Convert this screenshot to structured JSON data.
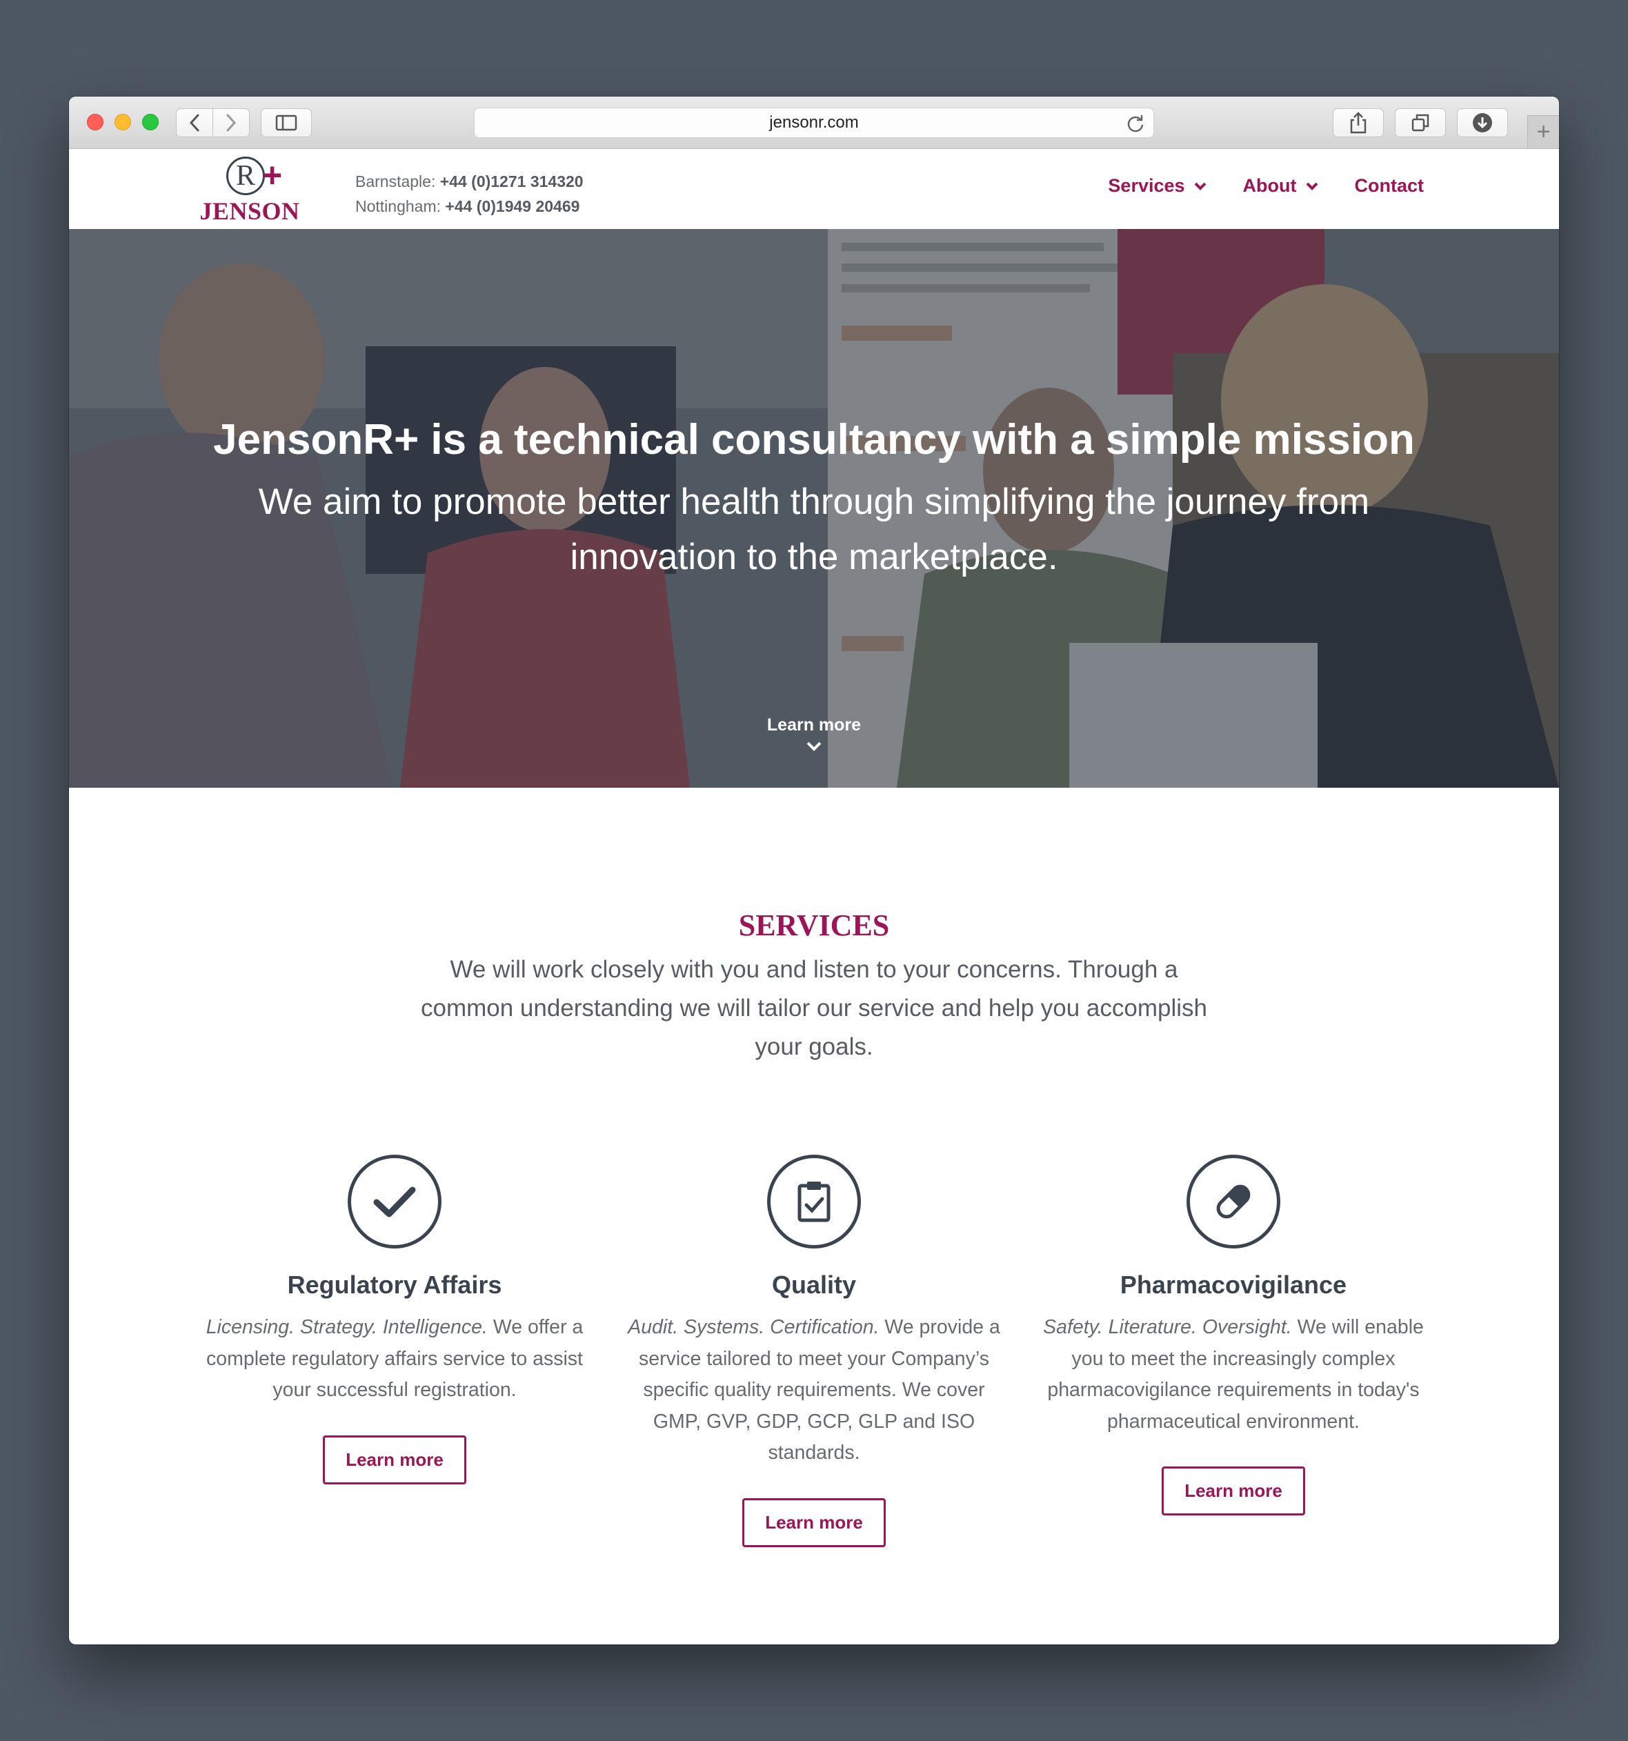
{
  "browser": {
    "url": "jensonr.com"
  },
  "header": {
    "logo_text": "JENSON",
    "contacts": [
      {
        "label": "Barnstaple:",
        "phone": "+44 (0)1271 314320"
      },
      {
        "label": "Nottingham:",
        "phone": "+44 (0)1949 20469"
      }
    ],
    "nav": [
      {
        "label": "Services",
        "has_dropdown": true
      },
      {
        "label": "About",
        "has_dropdown": true
      },
      {
        "label": "Contact",
        "has_dropdown": false
      }
    ]
  },
  "hero": {
    "title": "JensonR+ is a technical consultancy with a simple mission",
    "subtitle": "We aim to promote better health through simplifying the journey from innovation to the marketplace.",
    "learn_more": "Learn more"
  },
  "services": {
    "title": "SERVICES",
    "intro": "We will work closely with you and listen to your concerns. Through a common understanding we will tailor our service and help you accomplish your goals.",
    "items": [
      {
        "icon": "checkmark-icon",
        "title": "Regulatory Affairs",
        "lead": "Licensing. Strategy. Intelligence.",
        "text": " We offer a complete regulatory affairs service to assist your successful registration.",
        "button": "Learn more"
      },
      {
        "icon": "clipboard-check-icon",
        "title": "Quality",
        "lead": "Audit. Systems. Certification.",
        "text": " We provide a service tailored to meet your Company’s specific quality requirements. We cover GMP, GVP, GDP, GCP, GLP and ISO standards.",
        "button": "Learn more"
      },
      {
        "icon": "capsule-icon",
        "title": "Pharmacovigilance",
        "lead": "Safety. Literature. Oversight.",
        "text": " We will enable you to meet the increasingly complex pharmacovigilance requirements in today's pharmaceutical environment.",
        "button": "Learn more"
      }
    ]
  },
  "colors": {
    "brand": "#9c1657",
    "text_dark": "#3a4350",
    "desktop_background": "#4e5863"
  }
}
